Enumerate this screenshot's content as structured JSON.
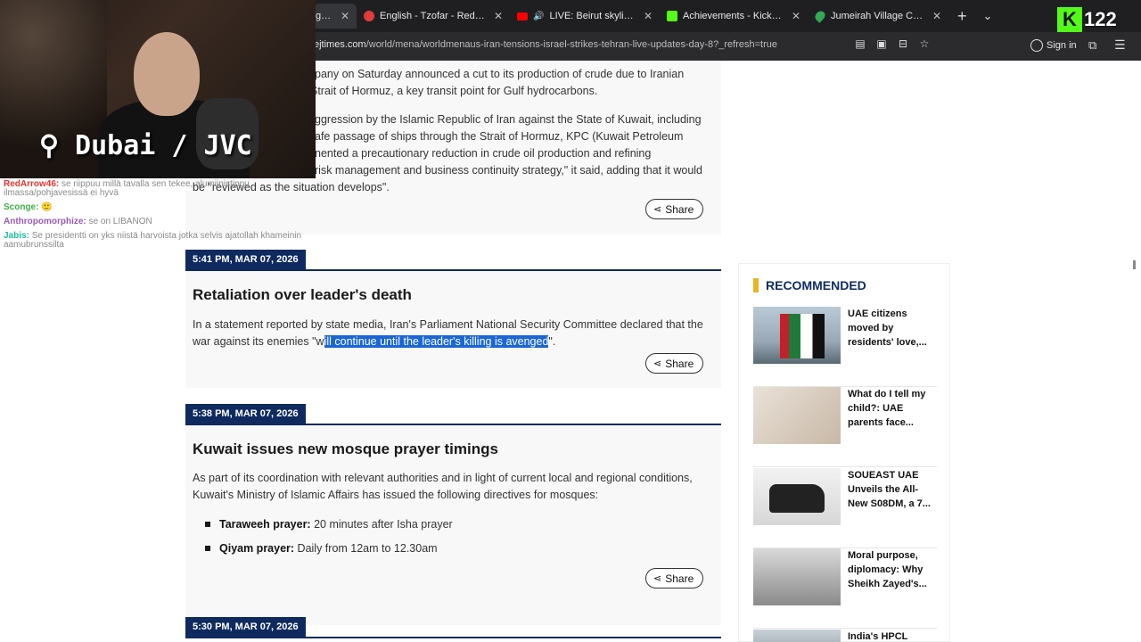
{
  "browser": {
    "tabs": [
      {
        "label": "ghbou",
        "color": "#666666",
        "active": true
      },
      {
        "label": "English - Tzofar - Red Alert",
        "color": "#e03c3c"
      },
      {
        "label": "LIVE: Beirut skyline as Is",
        "color": "#ff0000"
      },
      {
        "label": "Achievements - Kick Dashbo",
        "color": "#53fc18"
      },
      {
        "label": "Jumeirah Village Circle to Al",
        "color": "#34a853"
      }
    ],
    "new_tab": "+",
    "tab_list": "⌄",
    "url_host": "ejtimes.com",
    "url_path": "/world/mena/worldmenaus-iran-tensions-israel-strikes-tehran-live-updates-day-8?_refresh=true",
    "sign_in": "Sign in"
  },
  "overlay": {
    "kick_letter": "K",
    "viewer_count": "122",
    "location": "⚲ Dubai / JVC"
  },
  "chat": [
    {
      "user": "RedArrow46:",
      "text": "se riippuu millä tavalla sen tekee, alumiinistippu ilmassa/pohjavesissä ei hyvä",
      "color": "#e3342f"
    },
    {
      "user": "Sconge:",
      "text": "🙂",
      "color": "#3cb043"
    },
    {
      "user": "Anthropomorphize:",
      "text": "se on LIBANON",
      "color": "#9b59b6"
    },
    {
      "user": "Jabis:",
      "text": "Se presidentti on yks niistä harvoista jotka selvis ajatollah khameinin aamubrunssilta",
      "color": "#1abc9c"
    }
  ],
  "top_card": {
    "lines": [
      "pany on Saturday announced a cut to its production of crude due to Iranian",
      "Strait of Hormuz, a key transit point for Gulf hydrocarbons.",
      "ggression by the Islamic Republic of Iran against the State of Kuwait, including",
      "afe passage of ships through the Strait of Hormuz, KPC (Kuwait Petroleum",
      "nented a precautionary reduction in crude oil production and refining",
      "risk management and business continuity strategy,\" it said, adding that it would",
      "be \"reviewed as the situation develops\"."
    ],
    "share": "Share"
  },
  "entries": [
    {
      "time": "5:41 PM, MAR 07, 2026",
      "title": "Retaliation over leader's death",
      "text_before": "In a statement reported by state media, Iran's Parliament National Security Committee declared that the war against its enemies \"w",
      "text_highlight": "ill continue until the leader's killing is avenged",
      "text_after": "\".",
      "share": "Share"
    },
    {
      "time": "5:38 PM, MAR 07, 2026",
      "title": "Kuwait issues new mosque prayer timings",
      "text": "As part of its coordination with relevant authorities and in light of current local and regional conditions, Kuwait's Ministry of Islamic Affairs has issued the following directives for mosques:",
      "bullets": [
        {
          "label": "Taraweeh prayer:",
          "value": " 20 minutes after Isha prayer"
        },
        {
          "label": "Qiyam prayer:",
          "value": " Daily from 12am to 12.30am"
        }
      ],
      "share": "Share"
    },
    {
      "time": "5:30 PM, MAR 07, 2026"
    }
  ],
  "recommended": {
    "title": "RECOMMENDED",
    "items": [
      {
        "title": "UAE citizens moved by residents' love,..."
      },
      {
        "title": "What do I tell my child?: UAE parents face..."
      },
      {
        "title": "SOUEAST UAE Unveils the All-New S08DM, a 7..."
      },
      {
        "title": "Moral purpose, diplomacy: Why Sheikh Zayed's..."
      },
      {
        "title": "India's HPCL"
      }
    ]
  }
}
